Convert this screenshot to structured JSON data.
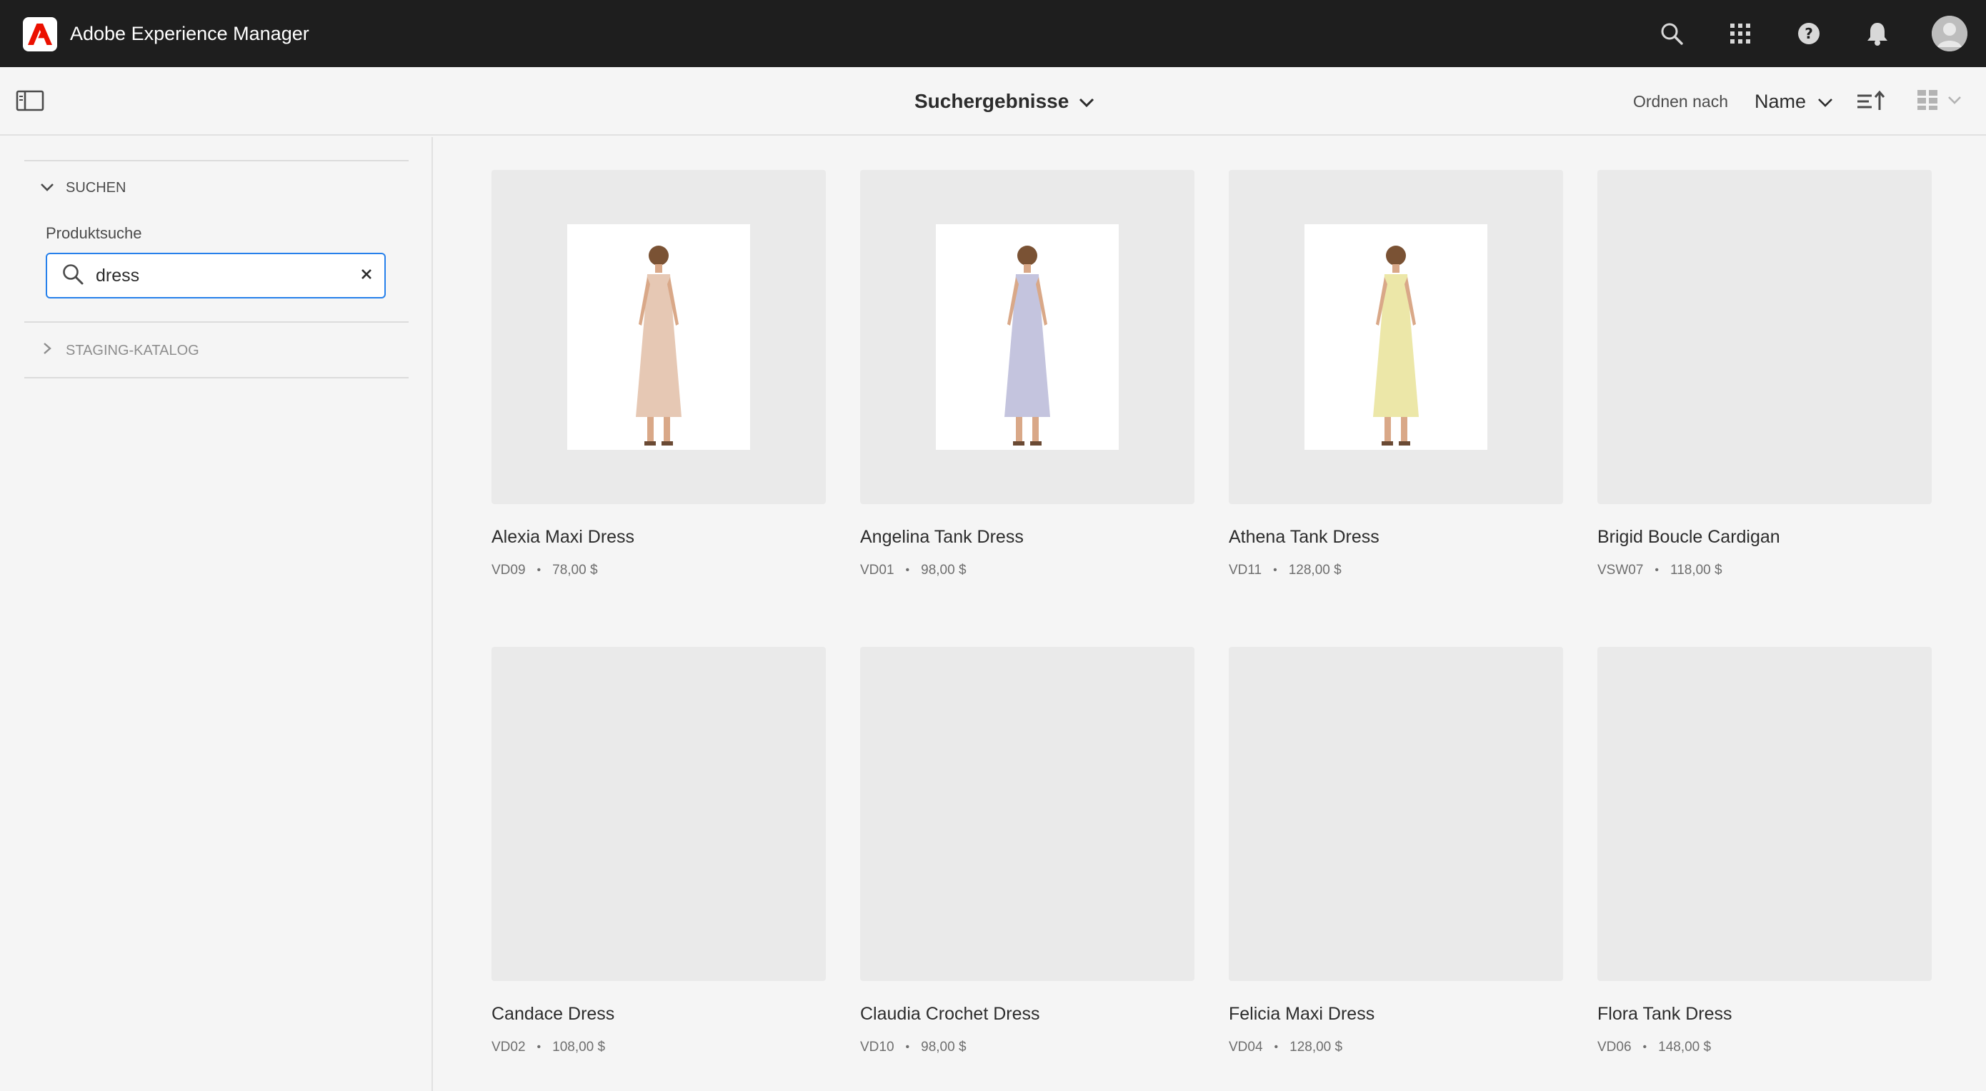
{
  "header": {
    "app_title": "Adobe Experience Manager",
    "icons": [
      "search-icon",
      "apps-grid-icon",
      "help-icon",
      "notifications-bell-icon",
      "user-avatar"
    ]
  },
  "actionbar": {
    "title": "Suchergebnisse",
    "sort_label": "Ordnen nach",
    "sort_value": "Name"
  },
  "rail": {
    "section_search": "SUCHEN",
    "field_label": "Produktsuche",
    "search_value": "dress",
    "section_catalog": "STAGING-KATALOG"
  },
  "products": [
    {
      "title": "Alexia Maxi Dress",
      "sku": "VD09",
      "price": "78,00 $",
      "has_image": true,
      "dress_color": "#e6c8b4"
    },
    {
      "title": "Angelina Tank Dress",
      "sku": "VD01",
      "price": "98,00 $",
      "has_image": true,
      "dress_color": "#c4c4de"
    },
    {
      "title": "Athena Tank Dress",
      "sku": "VD11",
      "price": "128,00 $",
      "has_image": true,
      "dress_color": "#ece7a8"
    },
    {
      "title": "Brigid Boucle Cardigan",
      "sku": "VSW07",
      "price": "118,00 $",
      "has_image": false
    },
    {
      "title": "Candace Dress",
      "sku": "VD02",
      "price": "108,00 $",
      "has_image": false
    },
    {
      "title": "Claudia Crochet Dress",
      "sku": "VD10",
      "price": "98,00 $",
      "has_image": false
    },
    {
      "title": "Felicia Maxi Dress",
      "sku": "VD04",
      "price": "128,00 $",
      "has_image": false
    },
    {
      "title": "Flora Tank Dress",
      "sku": "VD06",
      "price": "148,00 $",
      "has_image": false
    }
  ],
  "colors": {
    "shell_bg": "#1e1e1e",
    "adobe_red": "#eb1000",
    "focus_blue": "#2680eb",
    "thumb_bg": "#eaeaea"
  }
}
